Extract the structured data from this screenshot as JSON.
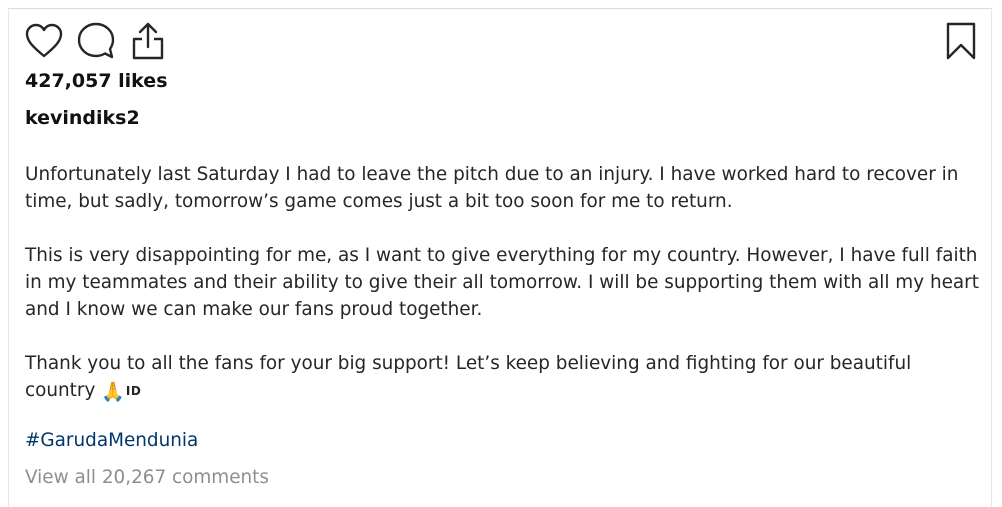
{
  "post": {
    "likes_text": "427,057 likes",
    "username": "kevindiks2",
    "caption": {
      "paragraph_1": "Unfortunately last Saturday I had to leave the pitch due to an injury. I have worked hard to recover in time, but sadly, tomorrow’s game comes just a bit too soon for me to return.",
      "paragraph_2": "This is very disappointing for me, as I want to give everything for my country. However, I have full faith in my teammates and their ability to give their all tomorrow. I will be supporting them with all my heart and I know we can make our fans proud together.",
      "paragraph_3": "Thank you to all the fans for your big support! Let’s keep believing and fighting for our beautiful country ",
      "emoji": "🙏",
      "flag_code": "ID"
    },
    "hashtag": "#GarudaMendunia",
    "view_comments_text": "View all 20,267 comments"
  },
  "icons": {
    "like": "heart-icon",
    "comment": "comment-bubble-icon",
    "share": "share-icon",
    "save": "bookmark-icon"
  },
  "colors": {
    "text": "#262626",
    "link": "#00376b",
    "muted": "#8e8e8e",
    "icon_stroke": "#262626"
  }
}
